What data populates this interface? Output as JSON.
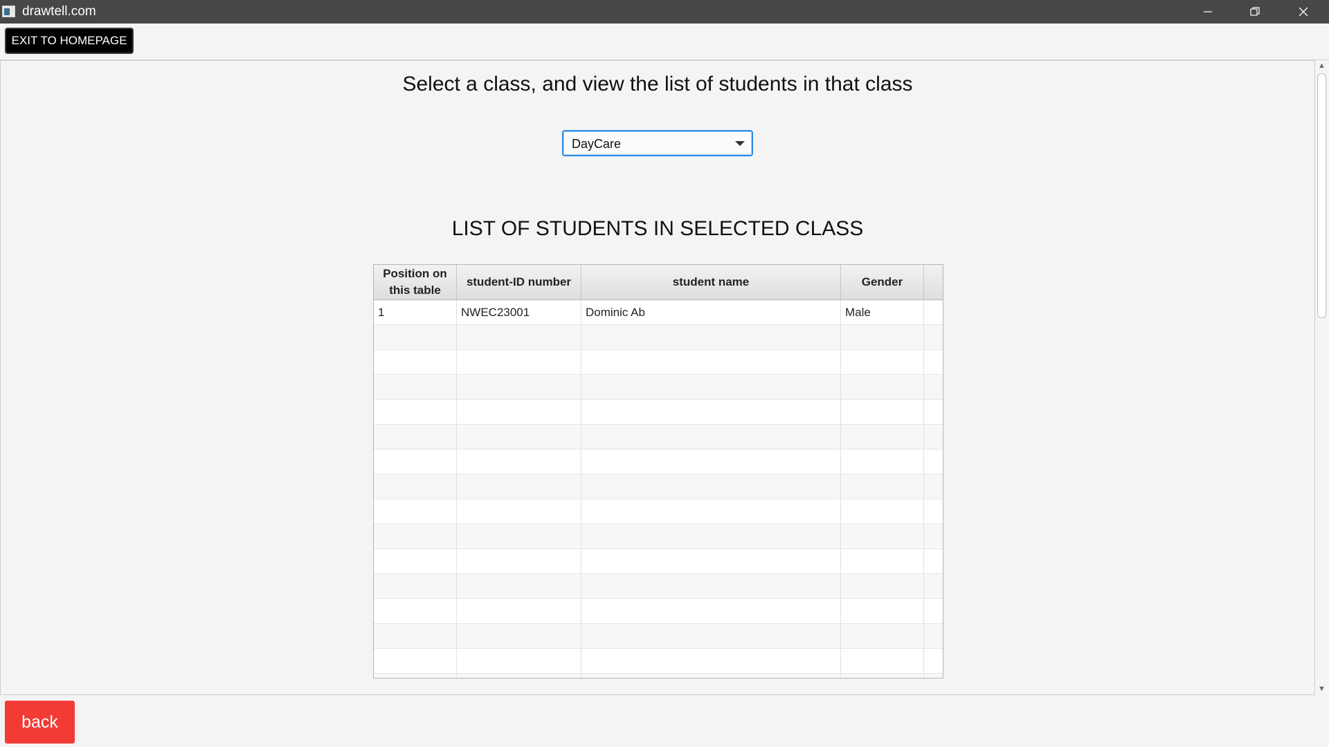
{
  "window": {
    "title": "drawtell.com"
  },
  "toolbar": {
    "exit_label": "EXIT TO HOMEPAGE"
  },
  "main": {
    "heading": "Select a class, and view the list of students in that class",
    "class_select": {
      "selected": "DayCare"
    },
    "list_title": "LIST OF STUDENTS IN SELECTED CLASS",
    "table": {
      "columns": [
        "Position on this table",
        "student-ID number",
        "student name",
        "Gender"
      ],
      "rows": [
        [
          "1",
          "NWEC23001",
          "Dominic Ab",
          "Male"
        ]
      ]
    }
  },
  "footer": {
    "back_label": "back"
  },
  "colors": {
    "title_bar": "#474747",
    "exit_button": "#000000",
    "back_button": "#f33b35",
    "select_focus": "#2a8be6"
  }
}
